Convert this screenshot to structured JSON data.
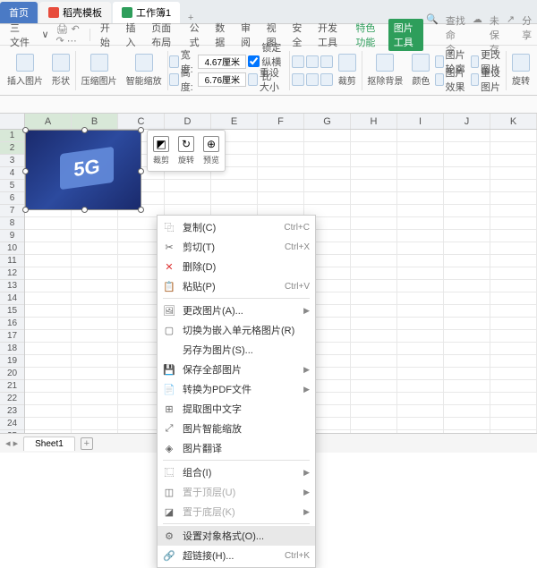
{
  "tabs": {
    "home": "首页",
    "home_icon": "#4a7ac5",
    "t1": "稻壳模板",
    "t1_icon": "#e74c3c",
    "t2": "工作簿1",
    "t2_icon": "#2e9e5b"
  },
  "menu": {
    "file": "三 文件",
    "arrow": "∨"
  },
  "ribbon_tabs": [
    "开始",
    "插入",
    "页面布局",
    "公式",
    "数据",
    "审阅",
    "视图",
    "安全",
    "开发工具",
    "特色功能",
    "图片工具"
  ],
  "ribbon_search": "查找命令…",
  "ribbon_save": "未保存",
  "ribbon_share": "分享",
  "rb": {
    "g1": "插入图片",
    "g2": "形状",
    "g3": "压缩图片",
    "g4": "智能缩放",
    "w_lbl": "宽度:",
    "h_lbl": "高度:",
    "w": "4.67厘米",
    "h": "6.76厘米",
    "lock": "锁定纵横比",
    "reset": "重设大小",
    "crop": "裁剪",
    "rmbg": "抠除背景",
    "color": "颜色",
    "outline": "图片轮廓",
    "change": "更改图片",
    "effect": "图片效果",
    "reset2": "重设图片",
    "rotate": "旋转"
  },
  "cols": [
    "A",
    "B",
    "C",
    "D",
    "E",
    "F",
    "G",
    "H",
    "I",
    "J",
    "K"
  ],
  "row_count": 25,
  "image_text": "5G",
  "float": {
    "crop": "裁剪",
    "rotate": "旋转",
    "preview": "预览"
  },
  "ctx": [
    {
      "icon": "⿻",
      "label": "复制(C)",
      "sc": "Ctrl+C"
    },
    {
      "icon": "✂",
      "label": "剪切(T)",
      "sc": "Ctrl+X"
    },
    {
      "icon": "✕",
      "label": "删除(D)",
      "red": true
    },
    {
      "icon": "📋",
      "label": "粘贴(P)",
      "sc": "Ctrl+V"
    },
    {
      "sep": true
    },
    {
      "icon": "🖼",
      "label": "更改图片(A)...",
      "arrow": true
    },
    {
      "icon": "▢",
      "label": "切换为嵌入单元格图片(R)"
    },
    {
      "label": "另存为图片(S)..."
    },
    {
      "icon": "💾",
      "label": "保存全部图片",
      "arrow": true
    },
    {
      "icon": "📄",
      "label": "转换为PDF文件",
      "arrow": true
    },
    {
      "icon": "⊞",
      "label": "提取图中文字"
    },
    {
      "icon": "⤢",
      "label": "图片智能缩放"
    },
    {
      "icon": "◈",
      "label": "图片翻译"
    },
    {
      "sep": true
    },
    {
      "icon": "⿺",
      "label": "组合(I)",
      "arrow": true
    },
    {
      "icon": "◫",
      "label": "置于顶层(U)",
      "arrow": true,
      "disabled": true
    },
    {
      "icon": "◪",
      "label": "置于底层(K)",
      "arrow": true,
      "disabled": true
    },
    {
      "sep": true
    },
    {
      "icon": "⚙",
      "label": "设置对象格式(O)...",
      "hover": true
    },
    {
      "icon": "🔗",
      "label": "超链接(H)...",
      "sc": "Ctrl+K"
    }
  ],
  "sheet": "Sheet1"
}
